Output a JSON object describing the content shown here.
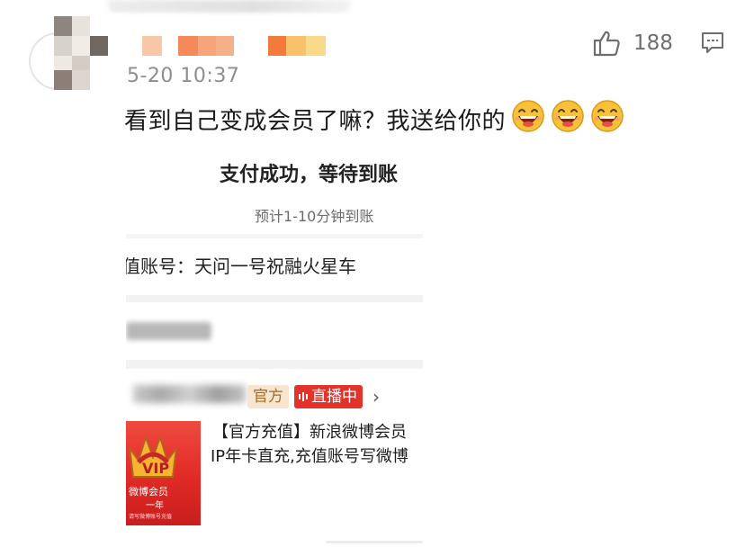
{
  "comment": {
    "likes": "188",
    "time": "5-20 10:37",
    "text": "看到自己变成会员了嘛？我送给你的",
    "emoji_count": 3,
    "emoji_name": "laughing-face-icon"
  },
  "screenshot": {
    "pay_title": "支付成功，等待到账",
    "pay_subtitle": "预计1-10分钟到账",
    "account_line": "值账号：天问一号祝融火星车",
    "tag_official": "官方",
    "tag_live": "直播中",
    "chevron": "›",
    "product": {
      "title_line1": "【官方充值】新浪微博会员",
      "title_line2": "IP年卡直充,充值账号写微博",
      "image_text1": "微博会员",
      "image_text2": "一年",
      "image_text3": "请写微博账号充值"
    }
  },
  "colors": {
    "live_tag": "#e2332a",
    "official_tag_bg": "#f6e5cf",
    "official_tag_text": "#a36a2a",
    "time_text": "#8e8e8e",
    "icon_gray": "#6e6e6e"
  }
}
